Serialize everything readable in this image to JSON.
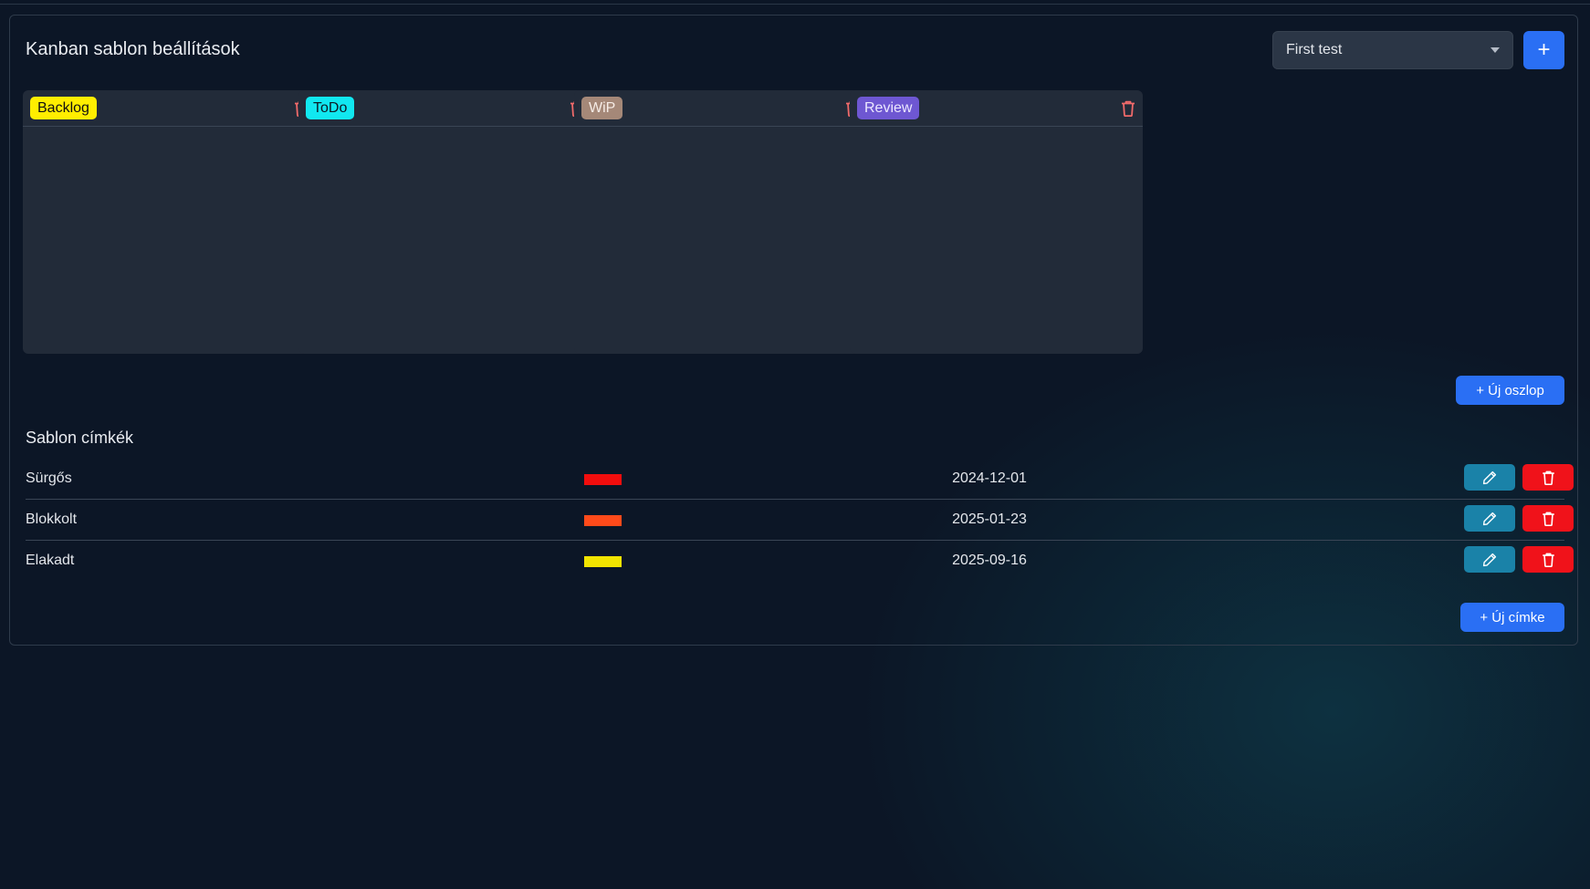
{
  "page": {
    "title": "Kanban sablon beállítások"
  },
  "template_selector": {
    "selected": "First test",
    "add_button_label": "+"
  },
  "columns": [
    {
      "label": "Backlog",
      "bg": "#ffee00",
      "fg": "#111111"
    },
    {
      "label": "ToDo",
      "bg": "#11e8f0",
      "fg": "#0d1a24"
    },
    {
      "label": "WiP",
      "bg": "#a58878",
      "fg": "#f6ece6"
    },
    {
      "label": "Review",
      "bg": "#6e57d2",
      "fg": "#ece8ff"
    }
  ],
  "new_column_button": "+ Új oszlop",
  "labels_section": {
    "title": "Sablon címkék",
    "rows": [
      {
        "name": "Sürgős",
        "color": "#f20d0d",
        "date": "2024-12-01"
      },
      {
        "name": "Blokkolt",
        "color": "#ff4a1a",
        "date": "2025-01-23"
      },
      {
        "name": "Elakadt",
        "color": "#f2e400",
        "date": "2025-09-16"
      }
    ],
    "new_label_button": "+ Új címke"
  },
  "icons": {
    "trash": "trash-icon",
    "edit": "pencil-icon",
    "caret": "chevron-down-icon",
    "plus": "plus-icon"
  }
}
